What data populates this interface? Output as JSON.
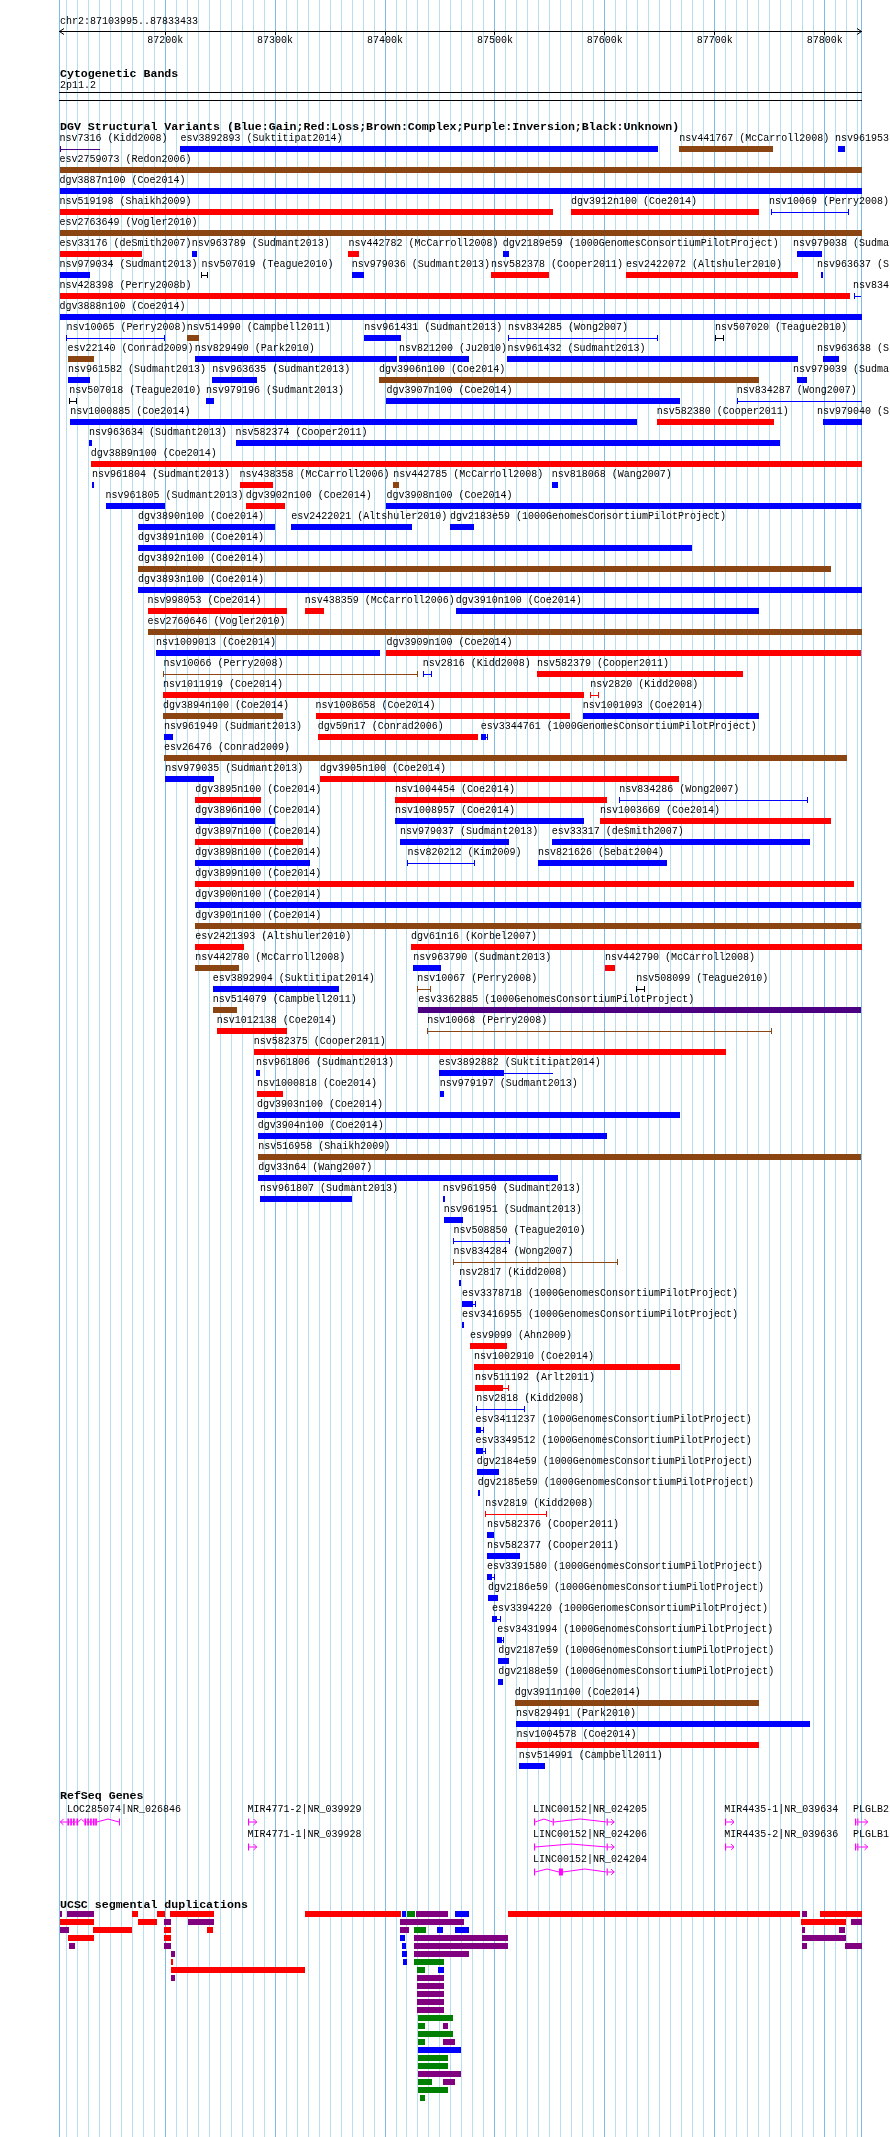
{
  "ruler": {
    "location": "chr2:87103995..87833433",
    "ticks": [
      "87200k",
      "87300k",
      "87400k",
      "87500k",
      "87600k",
      "87700k",
      "87800k"
    ]
  },
  "cytogenetic_bands": {
    "title": "Cytogenetic Bands",
    "bands": [
      {
        "label": "2p11.2"
      }
    ]
  },
  "dgv_structural_variants": {
    "title": "DGV Structural Variants (Blue:Gain;Red:Loss;Brown:Complex;Purple:Inversion;Black:Unknown)",
    "rows": [
      {
        "features": [
          {
            "label": "nsv7316 (Kidd2008)",
            "color": "#4b0082",
            "kind": "span"
          },
          {
            "label": "esv3892893 (Suktitipat2014)",
            "color": "#0000ff",
            "kind": "bar"
          },
          {
            "label": "nsv441767 (McCarroll2008)",
            "color": "#8b4513",
            "kind": "bar"
          },
          {
            "label": "nsv961953",
            "color": "#0000ff",
            "kind": "bar"
          }
        ]
      },
      {
        "features": [
          {
            "label": "esv2759073 (Redon2006)",
            "color": "#8b4513",
            "kind": "bar"
          }
        ]
      },
      {
        "features": [
          {
            "label": "dgv3887n100 (Coe2014)",
            "color": "#0000ff",
            "kind": "bar"
          }
        ]
      },
      {
        "features": [
          {
            "label": "nsv519198 (Shaikh2009)",
            "color": "#ff0000",
            "kind": "bar"
          },
          {
            "label": "dgv3912n100 (Coe2014)",
            "color": "#ff0000",
            "kind": "bar"
          },
          {
            "label": "nsv10069 (Perry2008)",
            "color": "#0000ff",
            "kind": "span"
          }
        ]
      },
      {
        "features": [
          {
            "label": "esv2763649 (Vogler2010)",
            "color": "#8b4513",
            "kind": "bar"
          }
        ]
      },
      {
        "features": [
          {
            "label": "esv33176 (deSmith2007)",
            "color": "#ff0000",
            "kind": "bar"
          },
          {
            "label": "nsv963789 (Sudmant2013)",
            "color": "#0000ff",
            "kind": "bar"
          },
          {
            "label": "nsv442782 (McCarroll2008)",
            "color": "#ff0000",
            "kind": "bar"
          },
          {
            "label": "dgv2189e59 (1000GenomesConsortiumPilotProject)",
            "color": "#0000ff",
            "kind": "bar"
          },
          {
            "label": "nsv979038 (Sudma",
            "color": "#0000ff",
            "kind": "bar"
          }
        ]
      },
      {
        "features": [
          {
            "label": "nsv979034 (Sudmant2013)",
            "color": "#0000ff",
            "kind": "bar"
          },
          {
            "label": "nsv507019 (Teague2010)",
            "color": "#000000",
            "kind": "span"
          },
          {
            "label": "nsv979036 (Sudmant2013)",
            "color": "#0000ff",
            "kind": "bar"
          },
          {
            "label": "nsv582378 (Cooper2011)",
            "color": "#ff0000",
            "kind": "bar"
          },
          {
            "label": "esv2422072 (Altshuler2010)",
            "color": "#ff0000",
            "kind": "bar"
          },
          {
            "label": "nsv963637 (S",
            "color": "#0000ff",
            "kind": "bar"
          }
        ]
      },
      {
        "features": [
          {
            "label": "nsv428398 (Perry2008b)",
            "color": "#ff0000",
            "kind": "bar"
          },
          {
            "label": "nsv834",
            "color": "#0000ff",
            "kind": "span"
          }
        ]
      },
      {
        "features": [
          {
            "label": "dgv3888n100 (Coe2014)",
            "color": "#0000ff",
            "kind": "bar"
          }
        ]
      },
      {
        "features": [
          {
            "label": "nsv10065 (Perry2008)",
            "color": "#0000ff",
            "kind": "span"
          },
          {
            "label": "nsv514990 (Campbell2011)",
            "color": "#8b4513",
            "kind": "bar"
          },
          {
            "label": "nsv961431 (Sudmant2013)",
            "color": "#0000ff",
            "kind": "bar"
          },
          {
            "label": "nsv834285 (Wong2007)",
            "color": "#0000ff",
            "kind": "span"
          },
          {
            "label": "nsv507020 (Teague2010)",
            "color": "#000000",
            "kind": "span"
          }
        ]
      },
      {
        "features": [
          {
            "label": "esv22140 (Conrad2009)",
            "color": "#8b4513",
            "kind": "bar"
          },
          {
            "label": "nsv829490 (Park2010)",
            "color": "#0000ff",
            "kind": "bar"
          },
          {
            "label": "nsv821200 (Ju2010)",
            "color": "#0000ff",
            "kind": "bar"
          },
          {
            "label": "nsv961432 (Sudmant2013)",
            "color": "#0000ff",
            "kind": "bar"
          },
          {
            "label": "nsv963638 (S",
            "color": "#0000ff",
            "kind": "bar"
          }
        ]
      },
      {
        "features": [
          {
            "label": "nsv961582 (Sudmant2013)",
            "color": "#0000ff",
            "kind": "bar"
          },
          {
            "label": "nsv963635 (Sudmant2013)",
            "color": "#0000ff",
            "kind": "bar"
          },
          {
            "label": "dgv3906n100 (Coe2014)",
            "color": "#8b4513",
            "kind": "bar"
          },
          {
            "label": "nsv979039 (Sudma",
            "color": "#0000ff",
            "kind": "bar"
          }
        ]
      },
      {
        "features": [
          {
            "label": "nsv507018 (Teague2010)",
            "color": "#000000",
            "kind": "span"
          },
          {
            "label": "nsv979196 (Sudmant2013)",
            "color": "#0000ff",
            "kind": "bar"
          },
          {
            "label": "dgv3907n100 (Coe2014)",
            "color": "#0000ff",
            "kind": "bar"
          },
          {
            "label": "nsv834287 (Wong2007)",
            "color": "#0000ff",
            "kind": "span"
          }
        ]
      },
      {
        "features": [
          {
            "label": "nsv1000885 (Coe2014)",
            "color": "#0000ff",
            "kind": "bar"
          },
          {
            "label": "nsv582380 (Cooper2011)",
            "color": "#ff0000",
            "kind": "bar"
          },
          {
            "label": "nsv979040 (S",
            "color": "#0000ff",
            "kind": "bar"
          }
        ]
      },
      {
        "features": [
          {
            "label": "nsv963634 (Sudmant2013)",
            "color": "#0000ff",
            "kind": "bar"
          },
          {
            "label": "nsv582374 (Cooper2011)",
            "color": "#0000ff",
            "kind": "bar"
          }
        ]
      },
      {
        "features": [
          {
            "label": "dgv3889n100 (Coe2014)",
            "color": "#ff0000",
            "kind": "bar"
          }
        ]
      },
      {
        "features": [
          {
            "label": "nsv961804 (Sudmant2013)",
            "color": "#0000ff",
            "kind": "bar"
          },
          {
            "label": "nsv438358 (McCarroll2006)",
            "color": "#ff0000",
            "kind": "bar"
          },
          {
            "label": "nsv442785 (McCarroll2008)",
            "color": "#8b4513",
            "kind": "bar"
          },
          {
            "label": "nsv818068 (Wang2007)",
            "color": "#0000ff",
            "kind": "bar"
          }
        ]
      },
      {
        "features": [
          {
            "label": "nsv961805 (Sudmant2013)",
            "color": "#0000ff",
            "kind": "bar"
          },
          {
            "label": "dgv3902n100 (Coe2014)",
            "color": "#ff0000",
            "kind": "bar"
          },
          {
            "label": "dgv3908n100 (Coe2014)",
            "color": "#0000ff",
            "kind": "bar"
          }
        ]
      },
      {
        "features": [
          {
            "label": "dgv3890n100 (Coe2014)",
            "color": "#0000ff",
            "kind": "bar"
          },
          {
            "label": "esv2422021 (Altshuler2010)",
            "color": "#0000ff",
            "kind": "bar"
          },
          {
            "label": "dgv2183e59 (1000GenomesConsortiumPilotProject)",
            "color": "#0000ff",
            "kind": "bar"
          }
        ]
      },
      {
        "features": [
          {
            "label": "dgv3891n100 (Coe2014)",
            "color": "#0000ff",
            "kind": "bar"
          }
        ]
      },
      {
        "features": [
          {
            "label": "dgv3892n100 (Coe2014)",
            "color": "#8b4513",
            "kind": "bar"
          }
        ]
      },
      {
        "features": [
          {
            "label": "dgv3893n100 (Coe2014)",
            "color": "#0000ff",
            "kind": "bar"
          }
        ]
      },
      {
        "features": [
          {
            "label": "nsv998053 (Coe2014)",
            "color": "#ff0000",
            "kind": "bar"
          },
          {
            "label": "nsv438359 (McCarroll2006)",
            "color": "#ff0000",
            "kind": "bar"
          },
          {
            "label": "dgv3910n100 (Coe2014)",
            "color": "#0000ff",
            "kind": "bar"
          }
        ]
      },
      {
        "features": [
          {
            "label": "esv2760646 (Vogler2010)",
            "color": "#8b4513",
            "kind": "bar"
          }
        ]
      },
      {
        "features": [
          {
            "label": "nsv1009013 (Coe2014)",
            "color": "#0000ff",
            "kind": "bar"
          },
          {
            "label": "dgv3909n100 (Coe2014)",
            "color": "#ff0000",
            "kind": "bar"
          }
        ]
      },
      {
        "features": [
          {
            "label": "nsv10066 (Perry2008)",
            "color": "#8b4513",
            "kind": "span"
          },
          {
            "label": "nsv2816 (Kidd2008)",
            "color": "#0000ff",
            "kind": "span"
          },
          {
            "label": "nsv582379 (Cooper2011)",
            "color": "#ff0000",
            "kind": "bar"
          }
        ]
      },
      {
        "features": [
          {
            "label": "nsv1011919 (Coe2014)",
            "color": "#ff0000",
            "kind": "bar"
          },
          {
            "label": "nsv2820 (Kidd2008)",
            "color": "#ff0000",
            "kind": "span"
          }
        ]
      },
      {
        "features": [
          {
            "label": "dgv3894n100 (Coe2014)",
            "color": "#8b4513",
            "kind": "bar"
          },
          {
            "label": "nsv1008658 (Coe2014)",
            "color": "#ff0000",
            "kind": "bar"
          },
          {
            "label": "nsv1001093 (Coe2014)",
            "color": "#0000ff",
            "kind": "bar"
          }
        ]
      },
      {
        "features": [
          {
            "label": "nsv961949 (Sudmant2013)",
            "color": "#0000ff",
            "kind": "bar"
          },
          {
            "label": "dgv59n17 (Conrad2006)",
            "color": "#ff0000",
            "kind": "bar"
          },
          {
            "label": "esv3344761 (1000GenomesConsortiumPilotProject)",
            "color": "#0000ff",
            "kind": "tailed"
          }
        ]
      },
      {
        "features": [
          {
            "label": "esv26476 (Conrad2009)",
            "color": "#8b4513",
            "kind": "bar"
          }
        ]
      },
      {
        "features": [
          {
            "label": "nsv979035 (Sudmant2013)",
            "color": "#0000ff",
            "kind": "bar"
          },
          {
            "label": "dgv3905n100 (Coe2014)",
            "color": "#ff0000",
            "kind": "bar"
          }
        ]
      },
      {
        "features": [
          {
            "label": "dgv3895n100 (Coe2014)",
            "color": "#ff0000",
            "kind": "bar"
          },
          {
            "label": "nsv1004454 (Coe2014)",
            "color": "#ff0000",
            "kind": "bar"
          },
          {
            "label": "nsv834286 (Wong2007)",
            "color": "#0000ff",
            "kind": "span"
          }
        ]
      },
      {
        "features": [
          {
            "label": "dgv3896n100 (Coe2014)",
            "color": "#0000ff",
            "kind": "bar"
          },
          {
            "label": "nsv1008957 (Coe2014)",
            "color": "#0000ff",
            "kind": "bar"
          },
          {
            "label": "nsv1003669 (Coe2014)",
            "color": "#ff0000",
            "kind": "bar"
          }
        ]
      },
      {
        "features": [
          {
            "label": "dgv3897n100 (Coe2014)",
            "color": "#ff0000",
            "kind": "bar"
          },
          {
            "label": "nsv979037 (Sudmant2013)",
            "color": "#0000ff",
            "kind": "bar"
          },
          {
            "label": "esv33317 (deSmith2007)",
            "color": "#0000ff",
            "kind": "bar"
          }
        ]
      },
      {
        "features": [
          {
            "label": "dgv3898n100 (Coe2014)",
            "color": "#0000ff",
            "kind": "bar"
          },
          {
            "label": "nsv820212 (Kim2009)",
            "color": "#0000ff",
            "kind": "span"
          },
          {
            "label": "nsv821626 (Sebat2004)",
            "color": "#0000ff",
            "kind": "bar"
          }
        ]
      },
      {
        "features": [
          {
            "label": "dgv3899n100 (Coe2014)",
            "color": "#ff0000",
            "kind": "bar"
          }
        ]
      },
      {
        "features": [
          {
            "label": "dgv3900n100 (Coe2014)",
            "color": "#0000ff",
            "kind": "bar"
          }
        ]
      },
      {
        "features": [
          {
            "label": "dgv3901n100 (Coe2014)",
            "color": "#8b4513",
            "kind": "bar"
          }
        ]
      },
      {
        "features": [
          {
            "label": "esv2421393 (Altshuler2010)",
            "color": "#ff0000",
            "kind": "bar"
          },
          {
            "label": "dgv61n16 (Korbel2007)",
            "color": "#ff0000",
            "kind": "bar"
          }
        ]
      },
      {
        "features": [
          {
            "label": "nsv442780 (McCarroll2008)",
            "color": "#8b4513",
            "kind": "bar"
          },
          {
            "label": "nsv963790 (Sudmant2013)",
            "color": "#0000ff",
            "kind": "bar"
          },
          {
            "label": "nsv442790 (McCarroll2008)",
            "color": "#ff0000",
            "kind": "bar"
          }
        ]
      },
      {
        "features": [
          {
            "label": "esv3892904 (Suktitipat2014)",
            "color": "#0000ff",
            "kind": "bar"
          },
          {
            "label": "nsv10067 (Perry2008)",
            "color": "#8b4513",
            "kind": "span"
          },
          {
            "label": "nsv508099 (Teague2010)",
            "color": "#000000",
            "kind": "span"
          }
        ]
      },
      {
        "features": [
          {
            "label": "nsv514079 (Campbell2011)",
            "color": "#8b4513",
            "kind": "bar"
          },
          {
            "label": "esv3362885 (1000GenomesConsortiumPilotProject)",
            "color": "#4b0082",
            "kind": "bar"
          }
        ]
      },
      {
        "features": [
          {
            "label": "nsv1012138 (Coe2014)",
            "color": "#ff0000",
            "kind": "bar"
          },
          {
            "label": "nsv10068 (Perry2008)",
            "color": "#8b4513",
            "kind": "span"
          }
        ]
      },
      {
        "features": [
          {
            "label": "nsv582375 (Cooper2011)",
            "color": "#ff0000",
            "kind": "bar"
          }
        ]
      },
      {
        "features": [
          {
            "label": "nsv961806 (Sudmant2013)",
            "color": "#0000ff",
            "kind": "bar"
          },
          {
            "label": "esv3892882 (Suktitipat2014)",
            "color": "#0000ff",
            "kind": "tailed"
          }
        ]
      },
      {
        "features": [
          {
            "label": "nsv1000818 (Coe2014)",
            "color": "#ff0000",
            "kind": "bar"
          },
          {
            "label": "nsv979197 (Sudmant2013)",
            "color": "#0000ff",
            "kind": "bar"
          }
        ]
      },
      {
        "features": [
          {
            "label": "dgv3903n100 (Coe2014)",
            "color": "#0000ff",
            "kind": "bar"
          }
        ]
      },
      {
        "features": [
          {
            "label": "dgv3904n100 (Coe2014)",
            "color": "#0000ff",
            "kind": "bar"
          }
        ]
      },
      {
        "features": [
          {
            "label": "nsv516958 (Shaikh2009)",
            "color": "#8b4513",
            "kind": "bar"
          }
        ]
      },
      {
        "features": [
          {
            "label": "dgv33n64 (Wang2007)",
            "color": "#0000ff",
            "kind": "bar"
          }
        ]
      },
      {
        "features": [
          {
            "label": "nsv961807 (Sudmant2013)",
            "color": "#0000ff",
            "kind": "bar"
          },
          {
            "label": "nsv961950 (Sudmant2013)",
            "color": "#0000ff",
            "kind": "bar"
          }
        ]
      },
      {
        "features": [
          {
            "label": "nsv961951 (Sudmant2013)",
            "color": "#0000ff",
            "kind": "bar"
          }
        ]
      },
      {
        "features": [
          {
            "label": "nsv508850 (Teague2010)",
            "color": "#0000ff",
            "kind": "span"
          }
        ]
      },
      {
        "features": [
          {
            "label": "nsv834284 (Wong2007)",
            "color": "#8b4513",
            "kind": "span"
          }
        ]
      },
      {
        "features": [
          {
            "label": "nsv2817 (Kidd2008)",
            "color": "#0000ff",
            "kind": "bar"
          }
        ]
      },
      {
        "features": [
          {
            "label": "esv3378718 (1000GenomesConsortiumPilotProject)",
            "color": "#0000ff",
            "kind": "tailed"
          }
        ]
      },
      {
        "features": [
          {
            "label": "esv3416955 (1000GenomesConsortiumPilotProject)",
            "color": "#0000ff",
            "kind": "bar"
          }
        ]
      },
      {
        "features": [
          {
            "label": "esv9099 (Ahn2009)",
            "color": "#ff0000",
            "kind": "bar"
          }
        ]
      },
      {
        "features": [
          {
            "label": "nsv1002910 (Coe2014)",
            "color": "#ff0000",
            "kind": "bar"
          }
        ]
      },
      {
        "features": [
          {
            "label": "nsv511192 (Arlt2011)",
            "color": "#ff0000",
            "kind": "tailed"
          }
        ]
      },
      {
        "features": [
          {
            "label": "nsv2818 (Kidd2008)",
            "color": "#0000ff",
            "kind": "span"
          }
        ]
      },
      {
        "features": [
          {
            "label": "esv3411237 (1000GenomesConsortiumPilotProject)",
            "color": "#0000ff",
            "kind": "tailed"
          }
        ]
      },
      {
        "features": [
          {
            "label": "esv3349512 (1000GenomesConsortiumPilotProject)",
            "color": "#0000ff",
            "kind": "tailed"
          }
        ]
      },
      {
        "features": [
          {
            "label": "dgv2184e59 (1000GenomesConsortiumPilotProject)",
            "color": "#0000ff",
            "kind": "bar"
          }
        ]
      },
      {
        "features": [
          {
            "label": "dgv2185e59 (1000GenomesConsortiumPilotProject)",
            "color": "#0000ff",
            "kind": "bar"
          }
        ]
      },
      {
        "features": [
          {
            "label": "nsv2819 (Kidd2008)",
            "color": "#ff0000",
            "kind": "span"
          }
        ]
      },
      {
        "features": [
          {
            "label": "nsv582376 (Cooper2011)",
            "color": "#0000ff",
            "kind": "bar"
          }
        ]
      },
      {
        "features": [
          {
            "label": "nsv582377 (Cooper2011)",
            "color": "#0000ff",
            "kind": "bar"
          }
        ]
      },
      {
        "features": [
          {
            "label": "esv3391580 (1000GenomesConsortiumPilotProject)",
            "color": "#0000ff",
            "kind": "tailed"
          }
        ]
      },
      {
        "features": [
          {
            "label": "dgv2186e59 (1000GenomesConsortiumPilotProject)",
            "color": "#0000ff",
            "kind": "bar"
          }
        ]
      },
      {
        "features": [
          {
            "label": "esv3394220 (1000GenomesConsortiumPilotProject)",
            "color": "#0000ff",
            "kind": "tailed"
          }
        ]
      },
      {
        "features": [
          {
            "label": "esv3431994 (1000GenomesConsortiumPilotProject)",
            "color": "#0000ff",
            "kind": "tailed"
          }
        ]
      },
      {
        "features": [
          {
            "label": "dgv2187e59 (1000GenomesConsortiumPilotProject)",
            "color": "#0000ff",
            "kind": "bar"
          }
        ]
      },
      {
        "features": [
          {
            "label": "dgv2188e59 (1000GenomesConsortiumPilotProject)",
            "color": "#0000ff",
            "kind": "bar"
          }
        ]
      },
      {
        "features": [
          {
            "label": "dgv3911n100 (Coe2014)",
            "color": "#8b4513",
            "kind": "bar"
          }
        ]
      },
      {
        "features": [
          {
            "label": "nsv829491 (Park2010)",
            "color": "#0000ff",
            "kind": "bar"
          }
        ]
      },
      {
        "features": [
          {
            "label": "nsv1004578 (Coe2014)",
            "color": "#ff0000",
            "kind": "bar"
          }
        ]
      },
      {
        "features": [
          {
            "label": "nsv514991 (Campbell2011)",
            "color": "#0000ff",
            "kind": "bar"
          }
        ]
      }
    ]
  },
  "refseq_genes": {
    "title": "RefSeq Genes",
    "rows": [
      {
        "genes": [
          {
            "label": "LOC285074|NR_026846",
            "reverse": true
          },
          {
            "label": "MIR4771-2|NR_039929",
            "reverse": false
          },
          {
            "label": "LINC00152|NR_024205",
            "reverse": false
          },
          {
            "label": "MIR4435-1|NR_039634",
            "reverse": false
          },
          {
            "label": "PLGLB2",
            "reverse": false
          }
        ]
      },
      {
        "genes": [
          {
            "label": "MIR4771-1|NR_039928",
            "reverse": false
          },
          {
            "label": "LINC00152|NR_024206",
            "reverse": false
          },
          {
            "label": "MIR4435-2|NR_039636",
            "reverse": false
          },
          {
            "label": "PLGLB1",
            "reverse": false
          }
        ]
      },
      {
        "genes": [
          {
            "label": "LINC00152|NR_024204",
            "reverse": false
          }
        ]
      }
    ]
  },
  "segmental_duplications": {
    "title": "UCSC segmental duplications",
    "series": [
      {
        "color": "#ff0000"
      },
      {
        "color": "#800080"
      },
      {
        "color": "#0000ff"
      },
      {
        "color": "#008000"
      }
    ]
  }
}
